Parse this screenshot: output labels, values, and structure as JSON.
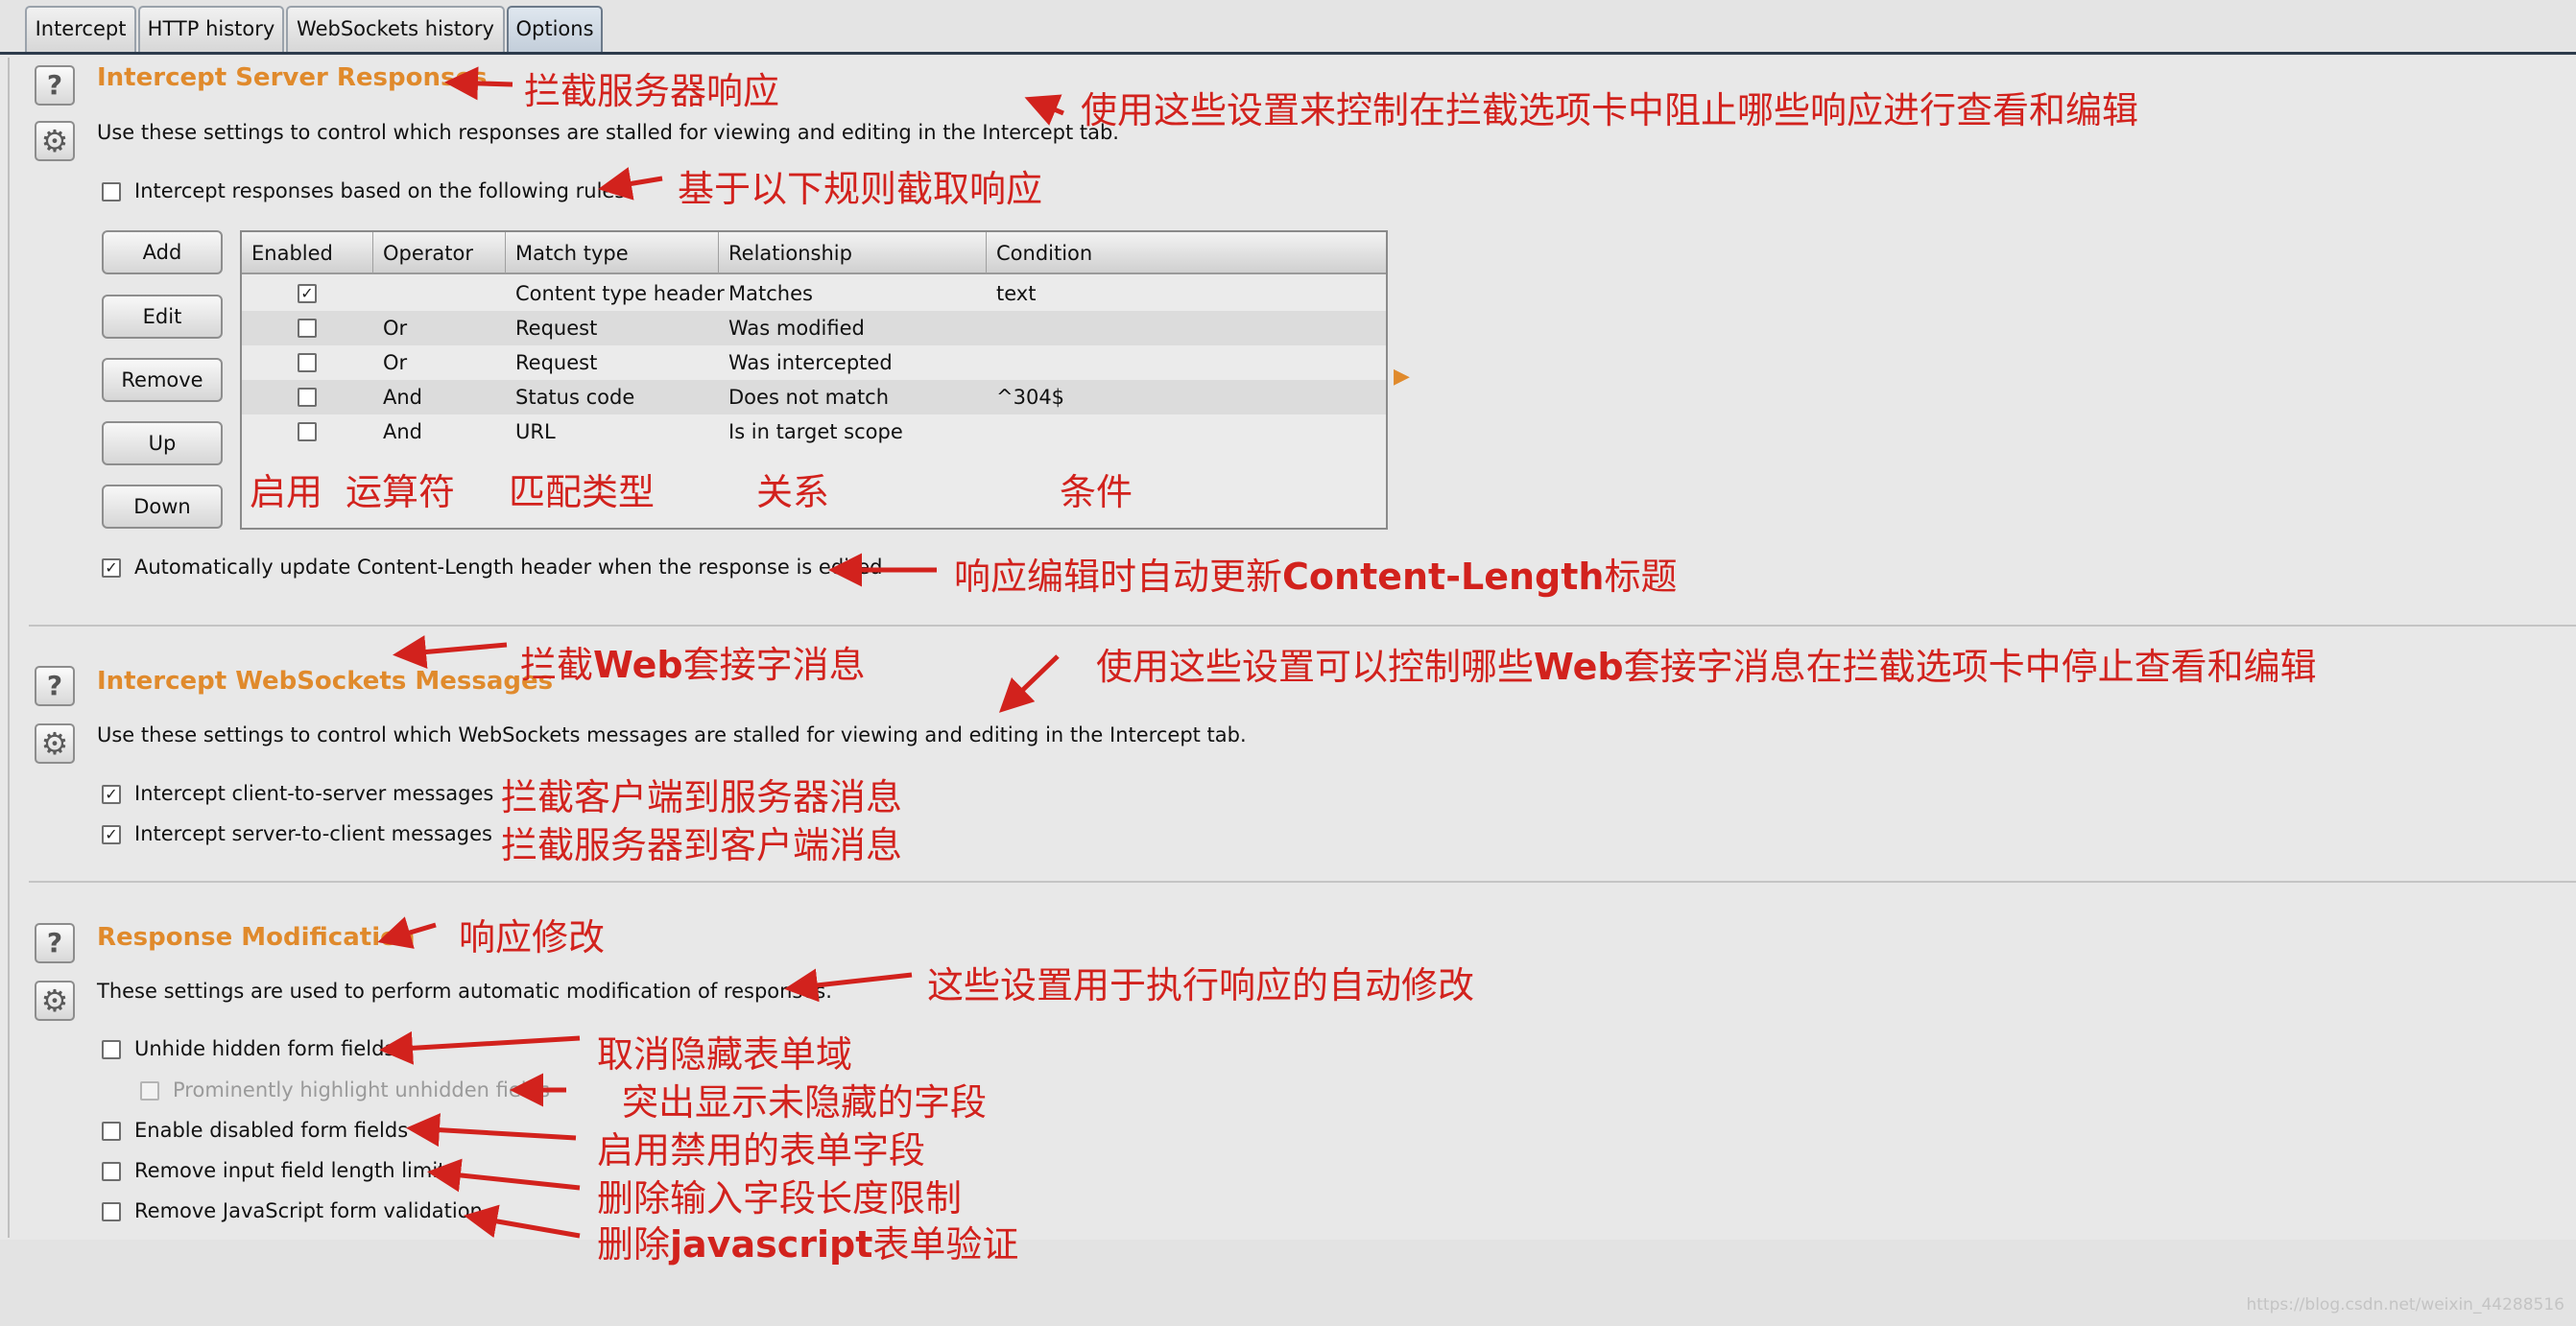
{
  "tabs": [
    {
      "label": "Intercept",
      "active": false
    },
    {
      "label": "HTTP history",
      "active": false
    },
    {
      "label": "WebSockets history",
      "active": false
    },
    {
      "label": "Options",
      "active": true
    }
  ],
  "section_server": {
    "heading": "Intercept Server Responses",
    "description": "Use these settings to control which responses are stalled for viewing and editing in the Intercept tab.",
    "rule_checkbox_label": "Intercept responses based on the following rules:",
    "rule_checkbox_checked": false,
    "buttons": [
      "Add",
      "Edit",
      "Remove",
      "Up",
      "Down"
    ],
    "table": {
      "columns": [
        "Enabled",
        "Operator",
        "Match type",
        "Relationship",
        "Condition"
      ],
      "rows": [
        {
          "enabled": true,
          "operator": "",
          "match_type": "Content type header",
          "relationship": "Matches",
          "condition": "text"
        },
        {
          "enabled": false,
          "operator": "Or",
          "match_type": "Request",
          "relationship": "Was modified",
          "condition": ""
        },
        {
          "enabled": false,
          "operator": "Or",
          "match_type": "Request",
          "relationship": "Was intercepted",
          "condition": ""
        },
        {
          "enabled": false,
          "operator": "And",
          "match_type": "Status code",
          "relationship": "Does not match",
          "condition": "^304$"
        },
        {
          "enabled": false,
          "operator": "And",
          "match_type": "URL",
          "relationship": "Is in target scope",
          "condition": ""
        }
      ]
    },
    "auto_update_label": "Automatically update Content-Length header when the response is edited",
    "auto_update_checked": true
  },
  "section_websockets": {
    "heading": "Intercept WebSockets Messages",
    "description": "Use these settings to control which WebSockets messages are stalled for viewing and editing in the Intercept tab.",
    "client_to_server_label": "Intercept client-to-server messages",
    "client_to_server_checked": true,
    "server_to_client_label": "Intercept server-to-client messages",
    "server_to_client_checked": true
  },
  "section_modification": {
    "heading": "Response Modification",
    "description": "These settings are used to perform automatic modification of responses.",
    "options": [
      {
        "label": "Unhide hidden form fields",
        "checked": false,
        "disabled": false
      },
      {
        "label": "Prominently highlight unhidden fields",
        "checked": false,
        "disabled": true
      },
      {
        "label": "Enable disabled form fields",
        "checked": false,
        "disabled": false
      },
      {
        "label": "Remove input field length limits",
        "checked": false,
        "disabled": false
      },
      {
        "label": "Remove JavaScript form validation",
        "checked": false,
        "disabled": false
      }
    ]
  },
  "annotations": {
    "server_heading": "拦截服务器响应",
    "server_desc": "使用这些设置来控制在拦截选项卡中阻止哪些响应进行查看和编辑",
    "rule_checkbox": "基于以下规则截取响应",
    "col_enabled": "启用",
    "col_operator": "运算符",
    "col_match_type": "匹配类型",
    "col_relationship": "关系",
    "col_condition": "条件",
    "auto_update_prefix": "响应编辑时自动更新",
    "auto_update_bold": "Content-Length",
    "auto_update_suffix": "标题",
    "ws_heading_prefix": "拦截",
    "ws_heading_bold": "Web",
    "ws_heading_suffix": "套接字消息",
    "ws_desc_prefix": "使用这些设置可以控制哪些",
    "ws_desc_bold": "Web",
    "ws_desc_suffix": "套接字消息在拦截选项卡中停止查看和编辑",
    "ws_client_to_server": "拦截客户端到服务器消息",
    "ws_server_to_client": "拦截服务器到客户端消息",
    "mod_heading": "响应修改",
    "mod_desc": "这些设置用于执行响应的自动修改",
    "mod_unhide": "取消隐藏表单域",
    "mod_highlight": "突出显示未隐藏的字段",
    "mod_enable_disabled": "启用禁用的表单字段",
    "mod_remove_length": "删除输入字段长度限制",
    "mod_remove_js_prefix": "删除",
    "mod_remove_js_bold": "javascript",
    "mod_remove_js_suffix": "表单验证"
  },
  "colors": {
    "heading": "#e08a2c",
    "annotation": "#d2221d",
    "tab_line": "#2d3b4c"
  },
  "icons": {
    "help": "?",
    "gear": "⚙",
    "check": "✓",
    "expand": "▶"
  },
  "watermark": "https://blog.csdn.net/weixin_44288516"
}
